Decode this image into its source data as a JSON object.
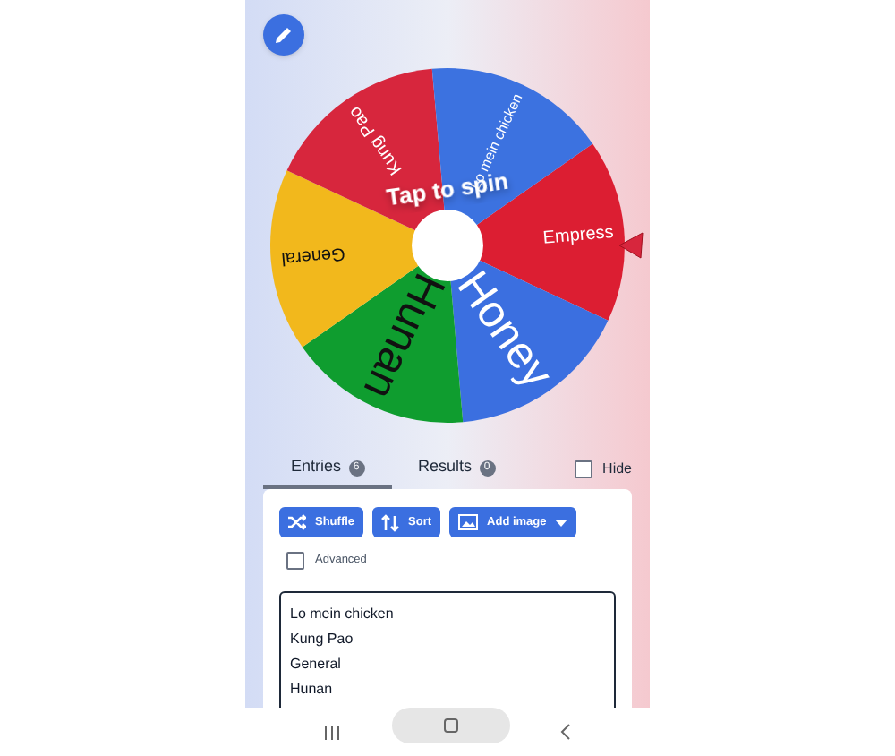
{
  "wheel": {
    "prompt": "Tap to spin",
    "slices": [
      {
        "label": "Empress",
        "color": "#dc1e32"
      },
      {
        "label": "Honey",
        "color": "#3b6fe0"
      },
      {
        "label": "Hunan",
        "color": "#0f9d2f"
      },
      {
        "label": "General",
        "color": "#f2b81c"
      },
      {
        "label": "Kung Pao",
        "color": "#d7263d"
      },
      {
        "label": "Lo mein chicken",
        "color": "#3c72e0"
      }
    ]
  },
  "tabs": [
    {
      "label": "Entries",
      "count": "6",
      "selected": true
    },
    {
      "label": "Results",
      "count": "0",
      "selected": false
    }
  ],
  "hide": {
    "label": "Hide",
    "checked": false
  },
  "buttons": [
    {
      "label": "Shuffle",
      "kind": "shuffle"
    },
    {
      "label": "Sort",
      "kind": "sort"
    },
    {
      "label": "Add image",
      "kind": "image"
    }
  ],
  "advanced": {
    "label": "Advanced",
    "checked": false
  },
  "entries": [
    "Lo mein chicken",
    "Kung Pao",
    "General",
    "Hunan"
  ]
}
